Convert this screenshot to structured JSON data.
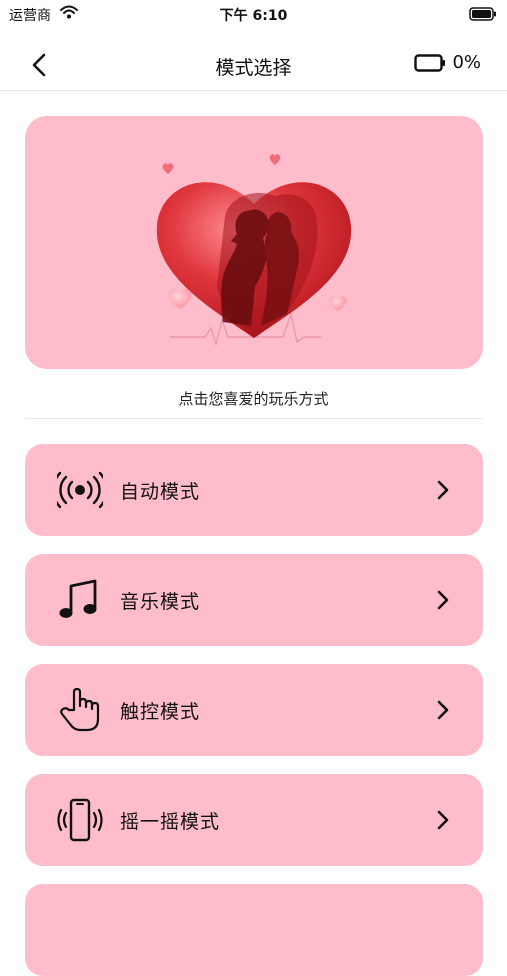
{
  "status_bar": {
    "carrier": "运营商",
    "time": "下午 6:10"
  },
  "nav": {
    "title": "模式选择",
    "battery_percent": "0%"
  },
  "banner": {
    "image": "kissing-couple-heart"
  },
  "hint": "点击您喜爱的玩乐方式",
  "modes": [
    {
      "label": "自动模式",
      "icon": "broadcast-icon"
    },
    {
      "label": "音乐模式",
      "icon": "music-note-icon"
    },
    {
      "label": "触控模式",
      "icon": "touch-hand-icon"
    },
    {
      "label": "摇一摇模式",
      "icon": "shake-phone-icon"
    }
  ],
  "colors": {
    "card": "#ffbdcc",
    "heart": "#d9363c",
    "background": "#ffffff"
  }
}
